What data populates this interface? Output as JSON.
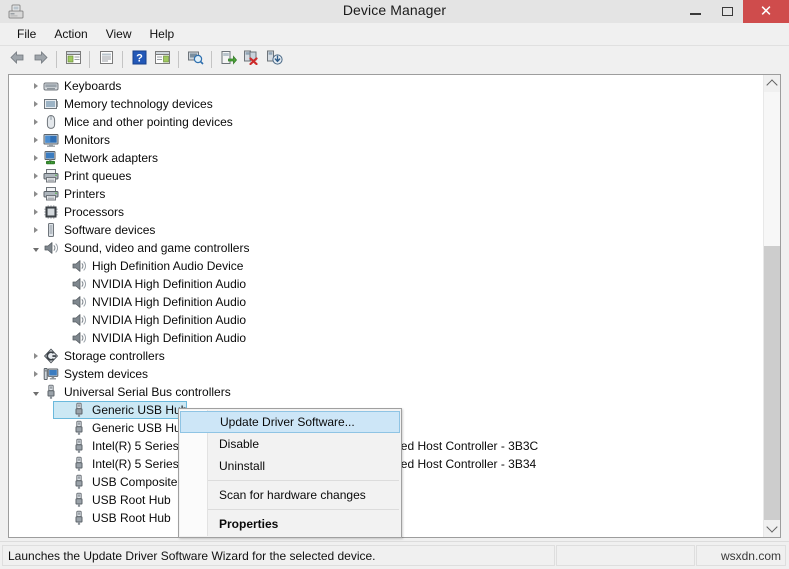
{
  "window": {
    "title": "Device Manager",
    "icon": "device-manager-icon",
    "buttons": {
      "minimize": "minimize-button",
      "maximize": "maximize-button",
      "close": "close-button",
      "close_glyph": "✕"
    }
  },
  "menubar": {
    "items": [
      {
        "label": "File"
      },
      {
        "label": "Action"
      },
      {
        "label": "View"
      },
      {
        "label": "Help"
      }
    ]
  },
  "toolbar": {
    "buttons": [
      {
        "name": "back-button",
        "icon": "back-arrow-icon"
      },
      {
        "name": "forward-button",
        "icon": "forward-arrow-icon"
      },
      {
        "name": "show-hide-console-tree-button",
        "icon": "console-tree-icon"
      },
      {
        "name": "properties-button",
        "icon": "properties-icon"
      },
      {
        "name": "help-button",
        "icon": "help-question-icon"
      },
      {
        "name": "show-hide-action-pane-button",
        "icon": "action-pane-icon"
      },
      {
        "name": "scan-for-hardware-changes-button",
        "icon": "scan-magnifier-icon"
      },
      {
        "name": "update-driver-software-button",
        "icon": "update-driver-icon"
      },
      {
        "name": "uninstall-button",
        "icon": "uninstall-red-x-icon"
      },
      {
        "name": "disable-button",
        "icon": "disable-down-arrow-icon"
      }
    ]
  },
  "tree": {
    "rows": [
      {
        "label": "Keyboards",
        "level": 1,
        "state": "collapsed",
        "icon": "keyboard-icon"
      },
      {
        "label": "Memory technology devices",
        "level": 1,
        "state": "collapsed",
        "icon": "memory-device-icon"
      },
      {
        "label": "Mice and other pointing devices",
        "level": 1,
        "state": "collapsed",
        "icon": "mouse-icon"
      },
      {
        "label": "Monitors",
        "level": 1,
        "state": "collapsed",
        "icon": "monitor-icon"
      },
      {
        "label": "Network adapters",
        "level": 1,
        "state": "collapsed",
        "icon": "network-adapter-icon"
      },
      {
        "label": "Print queues",
        "level": 1,
        "state": "collapsed",
        "icon": "printer-icon"
      },
      {
        "label": "Printers",
        "level": 1,
        "state": "collapsed",
        "icon": "printer-icon"
      },
      {
        "label": "Processors",
        "level": 1,
        "state": "collapsed",
        "icon": "processor-icon"
      },
      {
        "label": "Software devices",
        "level": 1,
        "state": "collapsed",
        "icon": "software-device-icon"
      },
      {
        "label": "Sound, video and game controllers",
        "level": 1,
        "state": "expanded",
        "icon": "speaker-icon"
      },
      {
        "label": "High Definition Audio Device",
        "level": 2,
        "state": "leaf",
        "icon": "speaker-icon"
      },
      {
        "label": "NVIDIA High Definition Audio",
        "level": 2,
        "state": "leaf",
        "icon": "speaker-icon"
      },
      {
        "label": "NVIDIA High Definition Audio",
        "level": 2,
        "state": "leaf",
        "icon": "speaker-icon"
      },
      {
        "label": "NVIDIA High Definition Audio",
        "level": 2,
        "state": "leaf",
        "icon": "speaker-icon"
      },
      {
        "label": "NVIDIA High Definition Audio",
        "level": 2,
        "state": "leaf",
        "icon": "speaker-icon"
      },
      {
        "label": "Storage controllers",
        "level": 1,
        "state": "collapsed",
        "icon": "storage-controller-icon"
      },
      {
        "label": "System devices",
        "level": 1,
        "state": "collapsed",
        "icon": "system-device-icon"
      },
      {
        "label": "Universal Serial Bus controllers",
        "level": 1,
        "state": "expanded",
        "icon": "usb-icon"
      },
      {
        "label": "Generic USB Hub",
        "level": 2,
        "state": "leaf",
        "icon": "usb-icon",
        "selected": true
      },
      {
        "label": "Generic USB Hub",
        "level": 2,
        "state": "leaf",
        "icon": "usb-icon"
      },
      {
        "label": "Intel(R) 5 Series/3400 Series Chipset Family USB Enhanced Host Controller - 3B3C",
        "level": 2,
        "state": "leaf",
        "icon": "usb-icon"
      },
      {
        "label": "Intel(R) 5 Series/3400 Series Chipset Family USB Enhanced Host Controller - 3B34",
        "level": 2,
        "state": "leaf",
        "icon": "usb-icon"
      },
      {
        "label": "USB Composite Device",
        "level": 2,
        "state": "leaf",
        "icon": "usb-icon"
      },
      {
        "label": "USB Root Hub",
        "level": 2,
        "state": "leaf",
        "icon": "usb-icon"
      },
      {
        "label": "USB Root Hub",
        "level": 2,
        "state": "leaf",
        "icon": "usb-icon"
      }
    ]
  },
  "context_menu": {
    "items": [
      {
        "label": "Update Driver Software...",
        "highlight": true,
        "bold": false
      },
      {
        "label": "Disable",
        "highlight": false,
        "bold": false
      },
      {
        "label": "Uninstall",
        "highlight": false,
        "bold": false
      },
      {
        "separator": true
      },
      {
        "label": "Scan for hardware changes",
        "highlight": false,
        "bold": false
      },
      {
        "separator": true
      },
      {
        "label": "Properties",
        "highlight": false,
        "bold": true
      }
    ]
  },
  "statusbar": {
    "message": "Launches the Update Driver Software Wizard for the selected device.",
    "panel2": "",
    "watermark": "wsxdn.com"
  },
  "scrollbar": {
    "up_arrow": "scroll-up-arrow",
    "down_arrow": "scroll-down-arrow",
    "thumb_top_pct": 36,
    "thumb_height_pct": 64
  },
  "colors": {
    "selection_fill": "#cce8f4",
    "selection_border": "#6bb9dc",
    "menu_highlight": "#cde6f7",
    "close_button": "#cf4c4c",
    "chrome": "#f0f0f0"
  }
}
